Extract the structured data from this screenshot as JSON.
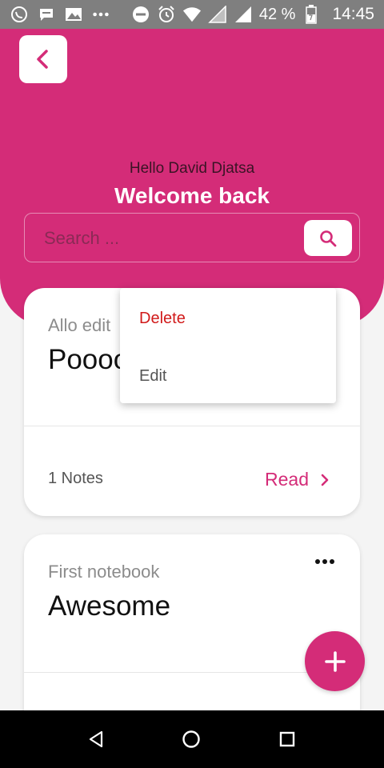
{
  "status_bar": {
    "battery_percent": "42 %",
    "time": "14:45",
    "icons": [
      "whatsapp-icon",
      "message-icon",
      "gallery-icon",
      "more-notifications-icon",
      "do-not-disturb-icon",
      "alarm-icon",
      "wifi-icon",
      "signal-icon",
      "battery-icon"
    ]
  },
  "header": {
    "greeting": "Hello David Djatsa",
    "welcome": "Welcome back",
    "back_icon": "chevron-left-icon",
    "search": {
      "placeholder": "Search ...",
      "value": "",
      "button_icon": "search-icon"
    }
  },
  "notebooks": [
    {
      "subtitle": "Allo edit",
      "title": "Poooo",
      "notes_count": "1 Notes",
      "read_label": "Read"
    },
    {
      "subtitle": "First notebook",
      "title": "Awesome"
    }
  ],
  "context_menu": {
    "items": [
      {
        "label": "Delete",
        "color": "#d11a1a"
      },
      {
        "label": "Edit",
        "color": "#555555"
      }
    ]
  },
  "fab": {
    "icon": "plus-icon"
  },
  "nav_bar": {
    "icons": [
      "back-triangle-icon",
      "home-circle-icon",
      "recent-apps-icon"
    ]
  },
  "colors": {
    "accent": "#d42c78",
    "status_bar": "#7f7f7f",
    "background": "#f4f4f4"
  }
}
